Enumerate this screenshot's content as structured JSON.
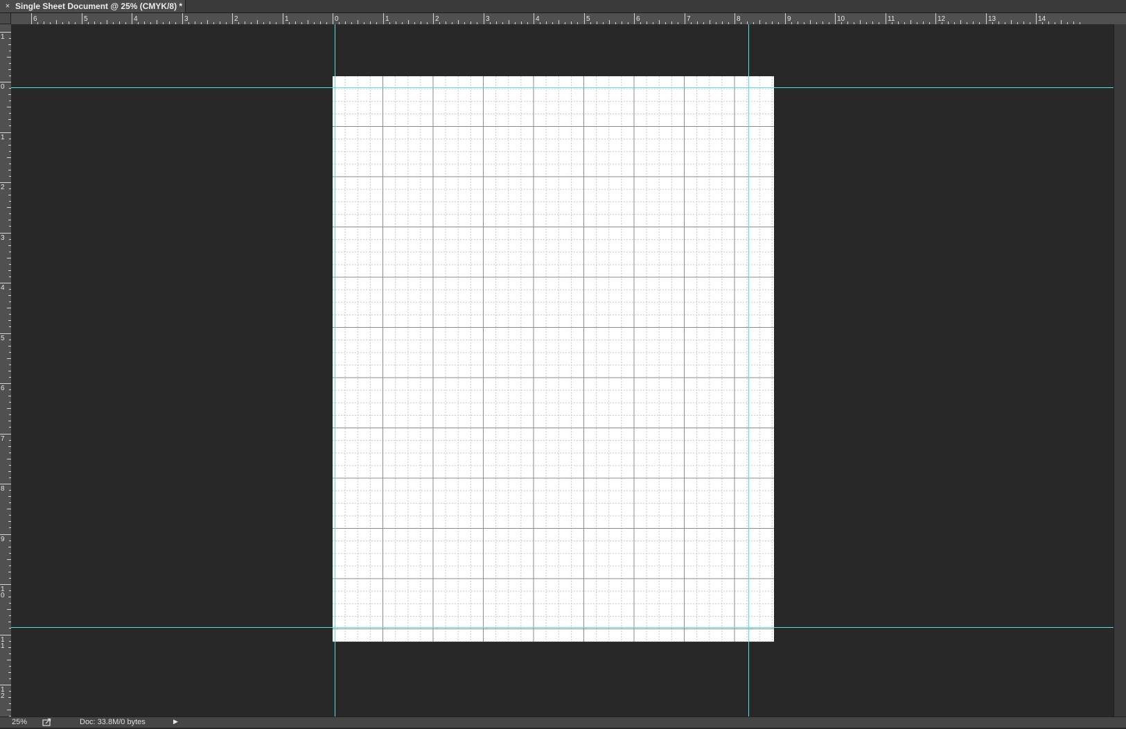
{
  "window": {
    "tab_close": "×",
    "title": "Single Sheet Document @ 25% (CMYK/8) *"
  },
  "rulers": {
    "horizontal_labels": [
      "6",
      "5",
      "4",
      "3",
      "2",
      "1",
      "0",
      "1",
      "2",
      "3",
      "4",
      "5",
      "6",
      "7",
      "8",
      "9",
      "10",
      "11",
      "12",
      "13",
      "14"
    ],
    "vertical_labels": [
      "1",
      "0",
      "1",
      "2",
      "3",
      "4",
      "5",
      "6",
      "7",
      "8",
      "9",
      "10",
      "11",
      "12"
    ],
    "unit": "inches"
  },
  "document": {
    "zoom": "25%",
    "color_mode": "CMYK/8",
    "paper_color": "#ffffff",
    "grid_color_major": "#8a8a8a",
    "grid_color_minor": "#c8c8c8",
    "guide_color": "#4fe3ea"
  },
  "status": {
    "zoom": "25%",
    "share_icon": "share-icon",
    "doc_info": "Doc: 33.8M/0 bytes",
    "menu_arrow": "▶"
  }
}
